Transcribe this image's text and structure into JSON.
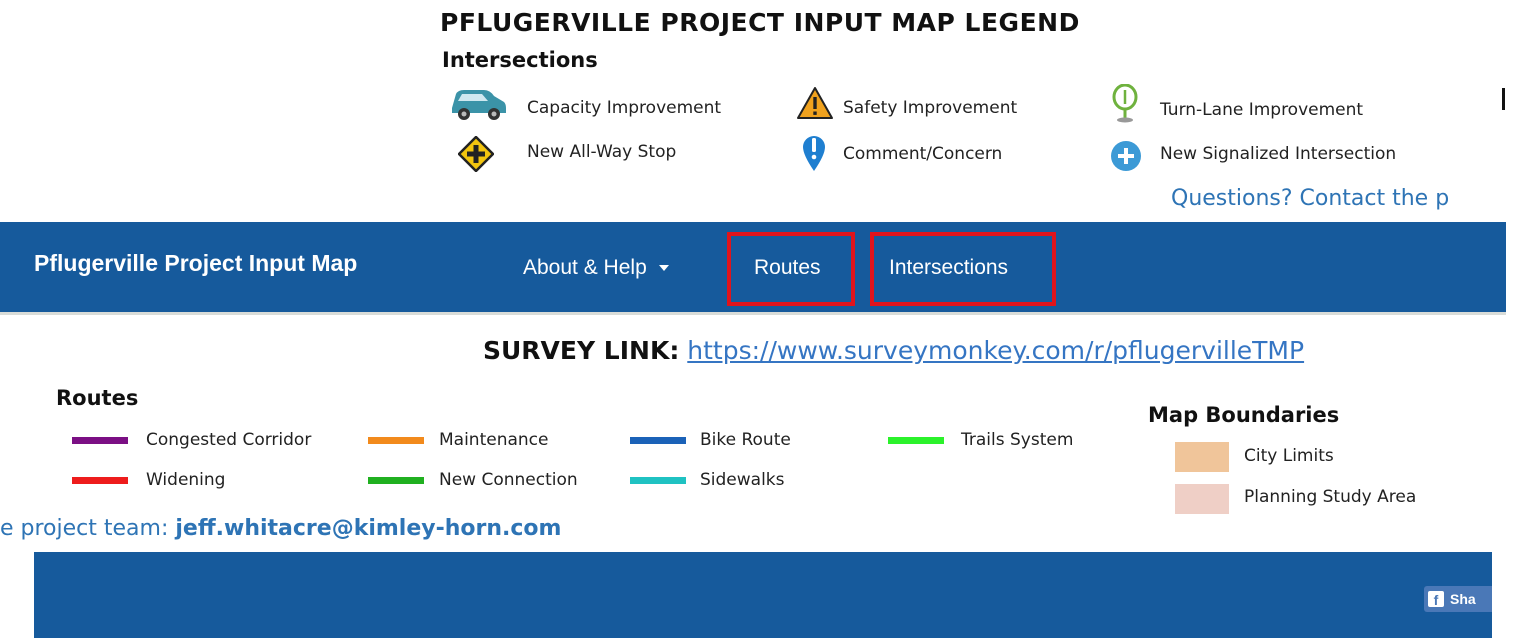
{
  "legend": {
    "title": "PFLUGERVILLE PROJECT INPUT MAP LEGEND",
    "intersections_heading": "Intersections",
    "intersections": [
      {
        "label": "Capacity Improvement",
        "icon": "car-icon"
      },
      {
        "label": "Safety Improvement",
        "icon": "warning-triangle-icon"
      },
      {
        "label": "Turn-Lane Improvement",
        "icon": "turn-lane-pin-icon"
      },
      {
        "label": "New All-Way Stop",
        "icon": "diamond-plus-sign-icon"
      },
      {
        "label": "Comment/Concern",
        "icon": "exclamation-pin-icon"
      },
      {
        "label": "New Signalized Intersection",
        "icon": "plus-circle-icon"
      }
    ],
    "questions_text": "Questions? Contact the p"
  },
  "navbar": {
    "brand": "Pflugerville Project Input Map",
    "about": "About & Help",
    "routes": "Routes",
    "intersections": "Intersections",
    "color": "#165a9c",
    "highlight_color": "#e0141c"
  },
  "survey": {
    "label": "SURVEY LINK:",
    "url": "https://www.surveymonkey.com/r/pflugervilleTMP"
  },
  "routes": {
    "heading": "Routes",
    "items": [
      {
        "label": "Congested Corridor",
        "color": "#7b0f84"
      },
      {
        "label": "Maintenance",
        "color": "#f28a1c"
      },
      {
        "label": "Bike Route",
        "color": "#1b62b8"
      },
      {
        "label": "Trails System",
        "color": "#2bf22b"
      },
      {
        "label": "Widening",
        "color": "#ee1c1c"
      },
      {
        "label": "New Connection",
        "color": "#20b020"
      },
      {
        "label": "Sidewalks",
        "color": "#1fc2c2"
      }
    ]
  },
  "boundaries": {
    "heading": "Map Boundaries",
    "items": [
      {
        "label": "City Limits",
        "color": "#f0c59a"
      },
      {
        "label": "Planning Study Area",
        "color": "#efcfc6"
      }
    ]
  },
  "contact": {
    "prefix": "e project team: ",
    "email": "jeff.whitacre@kimley-horn.com"
  },
  "footer": {
    "share_label": "Sha",
    "share_icon": "facebook-icon"
  }
}
